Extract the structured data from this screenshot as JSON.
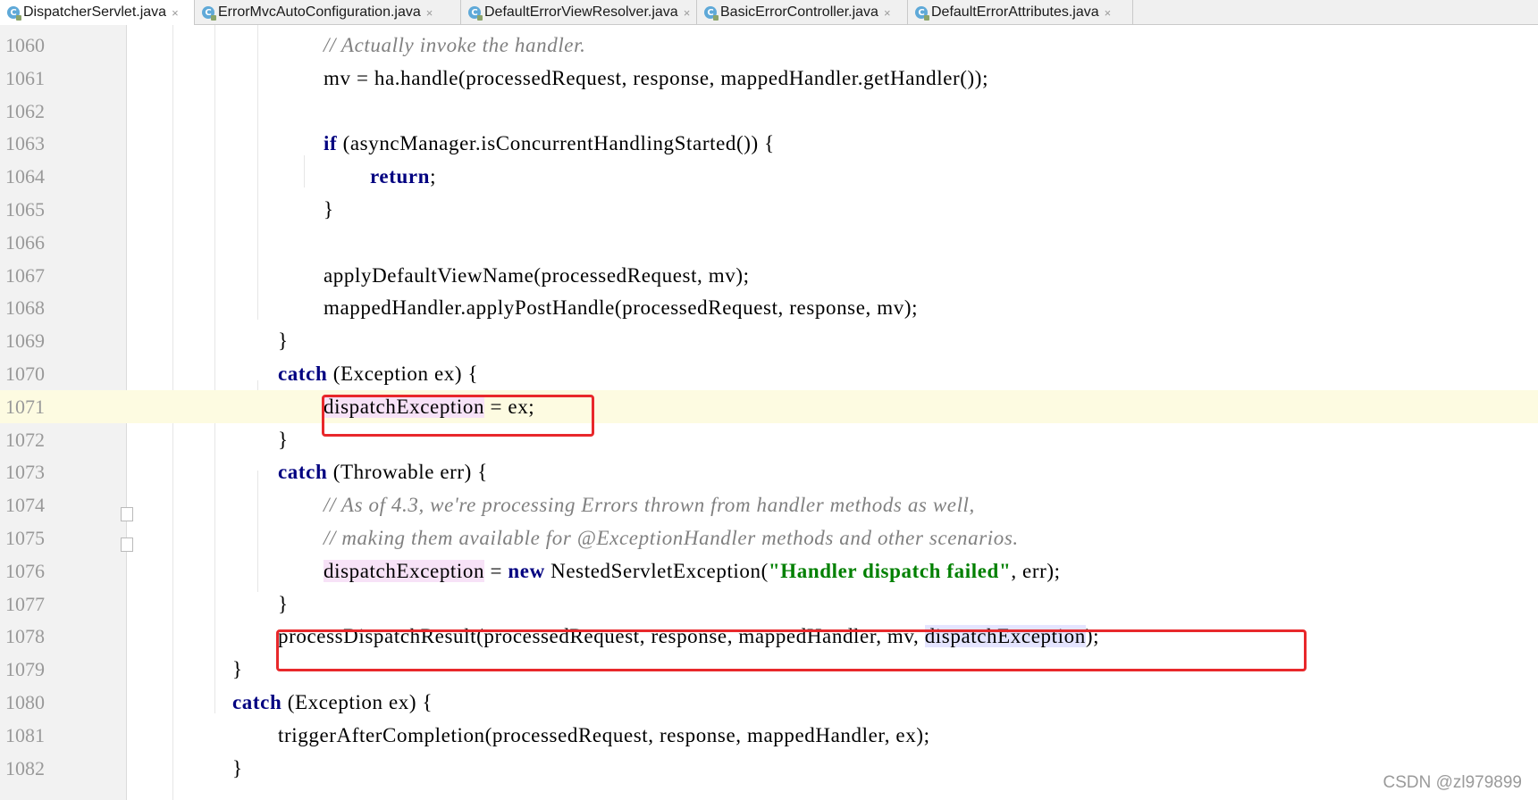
{
  "tabs": [
    {
      "label": "DispatcherServlet.java",
      "active": true
    },
    {
      "label": "ErrorMvcAutoConfiguration.java",
      "active": false
    },
    {
      "label": "DefaultErrorViewResolver.java",
      "active": false
    },
    {
      "label": "BasicErrorController.java",
      "active": false
    },
    {
      "label": "DefaultErrorAttributes.java",
      "active": false
    }
  ],
  "tab_icon": "class-file-icon",
  "close_glyph": "×",
  "lines": [
    {
      "num": "1060",
      "tokens": [
        {
          "t": "// Actually invoke the handler.",
          "c": "cm"
        }
      ]
    },
    {
      "num": "1061",
      "tokens": [
        {
          "t": "mv = ha.handle(processedRequest, response, mappedHandler.getHandler());",
          "c": ""
        }
      ]
    },
    {
      "num": "1062",
      "tokens": []
    },
    {
      "num": "1063",
      "tokens": [
        {
          "t": "if",
          "c": "kw"
        },
        {
          "t": " (asyncManager.isConcurrentHandlingStarted()) {",
          "c": ""
        }
      ]
    },
    {
      "num": "1064",
      "tokens": [
        {
          "t": "return",
          "c": "kw"
        },
        {
          "t": ";",
          "c": ""
        }
      ]
    },
    {
      "num": "1065",
      "tokens": [
        {
          "t": "}",
          "c": ""
        }
      ]
    },
    {
      "num": "1066",
      "tokens": []
    },
    {
      "num": "1067",
      "tokens": [
        {
          "t": "applyDefaultViewName(processedRequest, mv);",
          "c": ""
        }
      ]
    },
    {
      "num": "1068",
      "tokens": [
        {
          "t": "mappedHandler.applyPostHandle(processedRequest, response, mv);",
          "c": ""
        }
      ]
    },
    {
      "num": "1069",
      "tokens": [
        {
          "t": "}",
          "c": ""
        }
      ]
    },
    {
      "num": "1070",
      "tokens": [
        {
          "t": "catch",
          "c": "kw"
        },
        {
          "t": " (Exception ex) {",
          "c": ""
        }
      ]
    },
    {
      "num": "1071",
      "tokens": [
        {
          "t": "dispatchException",
          "c": "hl-pink"
        },
        {
          "t": " = ex;",
          "c": ""
        }
      ]
    },
    {
      "num": "1072",
      "tokens": [
        {
          "t": "}",
          "c": ""
        }
      ]
    },
    {
      "num": "1073",
      "tokens": [
        {
          "t": "catch",
          "c": "kw"
        },
        {
          "t": " (Throwable err) {",
          "c": ""
        }
      ]
    },
    {
      "num": "1074",
      "tokens": [
        {
          "t": "// As of 4.3, we're processing Errors thrown from handler methods as well,",
          "c": "cm"
        }
      ]
    },
    {
      "num": "1075",
      "tokens": [
        {
          "t": "// making them available for @ExceptionHandler methods and other scenarios.",
          "c": "cm"
        }
      ]
    },
    {
      "num": "1076",
      "tokens": [
        {
          "t": "dispatchException",
          "c": "hl-pink"
        },
        {
          "t": " = ",
          "c": ""
        },
        {
          "t": "new",
          "c": "kw"
        },
        {
          "t": " NestedServletException(",
          "c": ""
        },
        {
          "t": "\"Handler dispatch failed\"",
          "c": "str"
        },
        {
          "t": ", err);",
          "c": ""
        }
      ]
    },
    {
      "num": "1077",
      "tokens": [
        {
          "t": "}",
          "c": ""
        }
      ]
    },
    {
      "num": "1078",
      "tokens": [
        {
          "t": "processDispatchResult(processedRequest, response, mappedHandler, mv, ",
          "c": ""
        },
        {
          "t": "dispatchException",
          "c": "hl-blue"
        },
        {
          "t": ");",
          "c": ""
        }
      ]
    },
    {
      "num": "1079",
      "tokens": [
        {
          "t": "}",
          "c": ""
        }
      ]
    },
    {
      "num": "1080",
      "tokens": [
        {
          "t": "catch",
          "c": "kw"
        },
        {
          "t": " (Exception ex) {",
          "c": ""
        }
      ]
    },
    {
      "num": "1081",
      "tokens": [
        {
          "t": "triggerAfterCompletion(processedRequest, response, mappedHandler, ex);",
          "c": ""
        }
      ]
    },
    {
      "num": "1082",
      "tokens": [
        {
          "t": "}",
          "c": ""
        }
      ]
    }
  ],
  "current_line": "1071",
  "watermark": "CSDN @zl979899"
}
